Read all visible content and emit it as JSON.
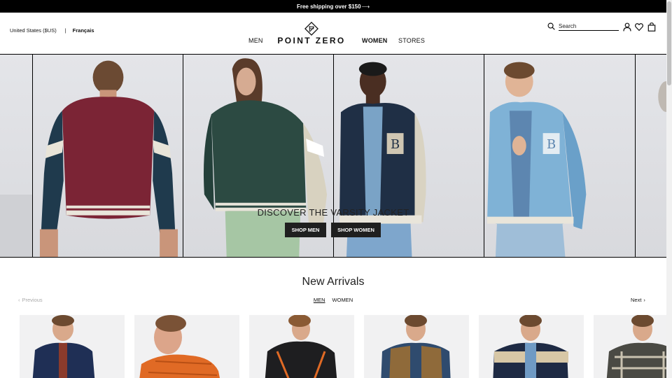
{
  "promo": {
    "text": "Free shipping over $150",
    "arrow": "⟶"
  },
  "header": {
    "locale": {
      "country": "United States ($US)",
      "separator": "|",
      "language": "Français"
    },
    "nav": {
      "men": "MEN",
      "women": "WOMEN",
      "stores": "STORES"
    },
    "logo_text": "POINT ZERO",
    "search": {
      "placeholder": "Search",
      "value": ""
    },
    "icons": [
      "search-icon",
      "account-icon",
      "heart-icon",
      "bag-icon"
    ]
  },
  "hero": {
    "title": "DISCOVER THE VARSITY JACKET",
    "buttons": {
      "men": "SHOP MEN",
      "women": "SHOP WOMEN"
    }
  },
  "new_arrivals": {
    "title": "New Arrivals",
    "prev": "Previous",
    "next": "Next",
    "tabs": {
      "men": "MEN",
      "women": "WOMEN"
    }
  },
  "colors": {
    "promo_bg": "#000000",
    "button_bg": "#1f1f1f",
    "jacket_burgundy": "#7b2435",
    "jacket_green": "#2c4a42",
    "jacket_navy": "#1f2f45",
    "jacket_lightblue": "#7fb2d6"
  }
}
